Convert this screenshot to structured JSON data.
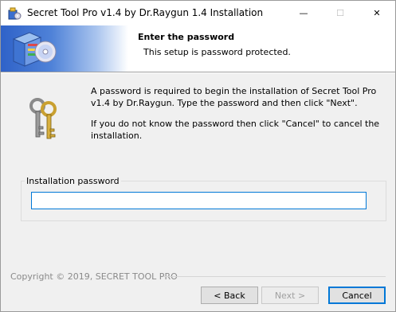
{
  "window": {
    "title": "Secret Tool Pro v1.4 by Dr.Raygun 1.4 Installation",
    "minimize_glyph": "—",
    "maximize_glyph": "☐",
    "close_glyph": "✕"
  },
  "banner": {
    "title": "Enter the password",
    "subtitle": "This setup is password protected."
  },
  "info": {
    "paragraph1": "A password is required to begin the installation of Secret Tool Pro v1.4 by Dr.Raygun. Type the password and then click \"Next\".",
    "paragraph2": "If you do not know the password then click \"Cancel\" to cancel the installation."
  },
  "password": {
    "label": "Installation password",
    "value": ""
  },
  "footer": {
    "copyright": "Copyright © 2019, SECRET TOOL PRO"
  },
  "buttons": {
    "back": "< Back",
    "next": "Next >",
    "cancel": "Cancel"
  },
  "colors": {
    "accent": "#0078d7",
    "banner_blue": "#2f62c8"
  },
  "icons": {
    "app": "installer-box-icon",
    "banner": "software-box-cd-icon",
    "body": "keys-icon"
  }
}
